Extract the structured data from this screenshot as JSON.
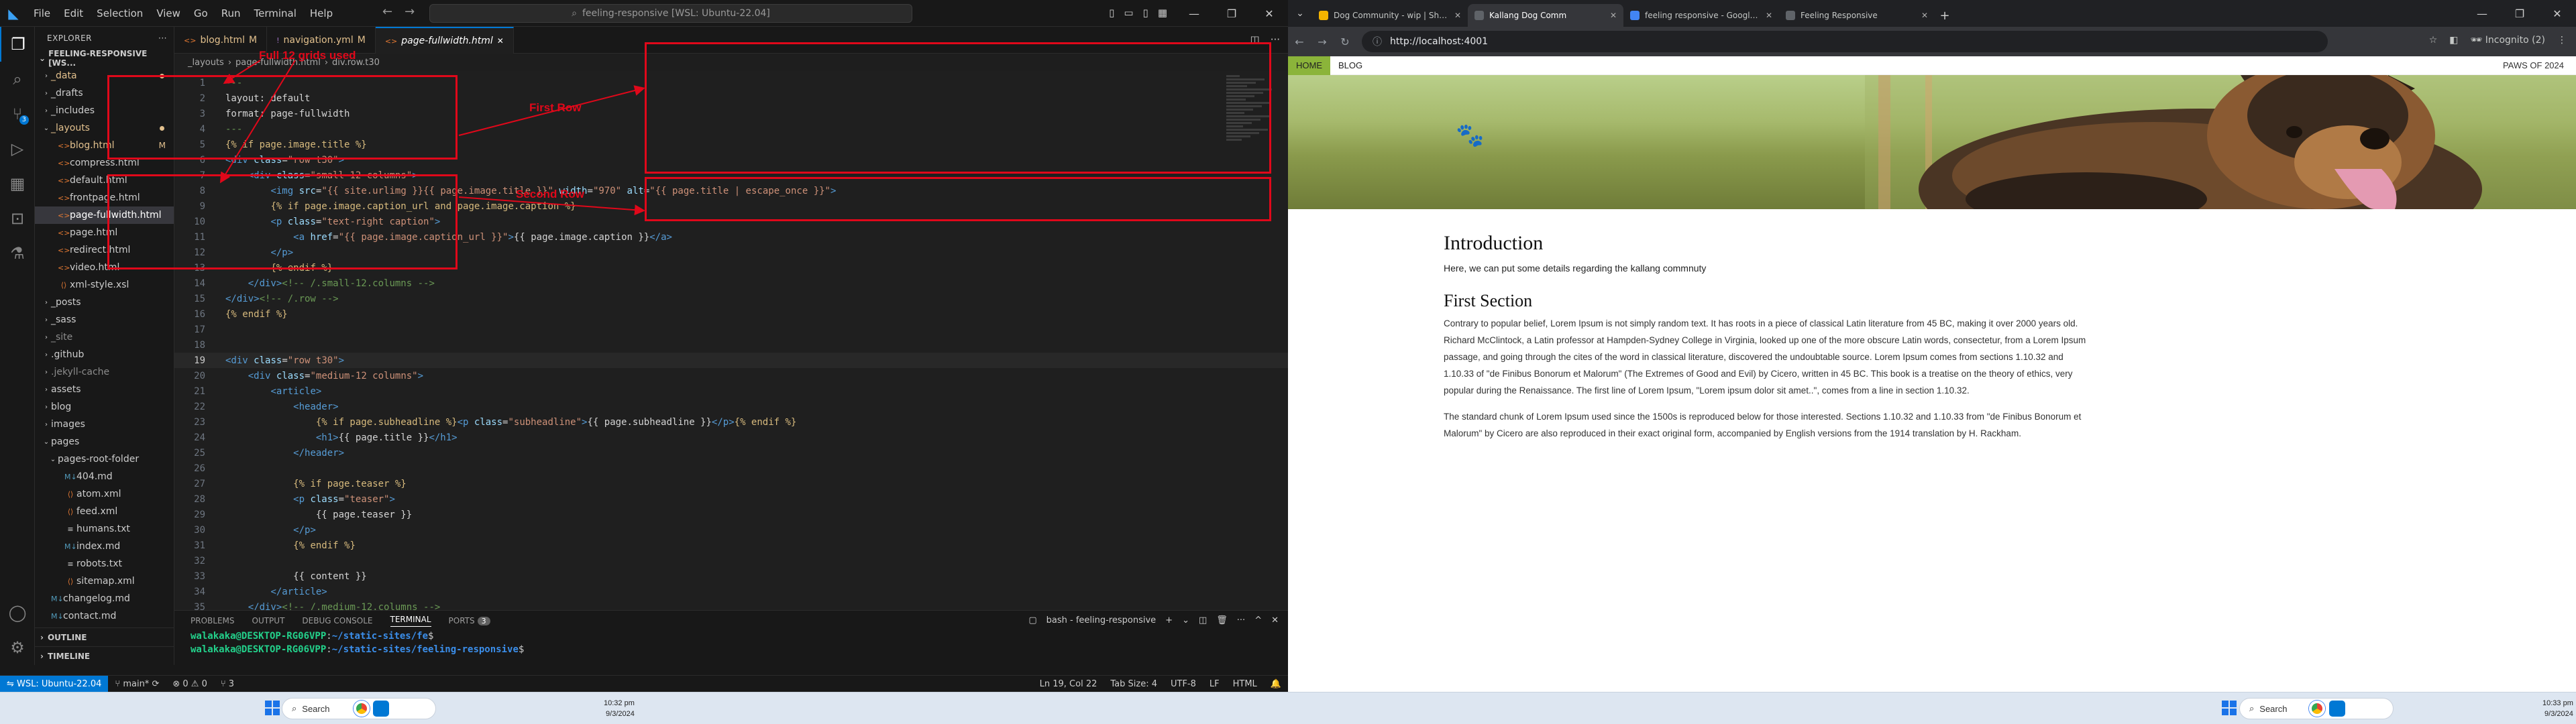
{
  "vscode": {
    "title": "feeling-responsive [WSL: Ubuntu-22.04]",
    "menu": [
      "File",
      "Edit",
      "Selection",
      "View",
      "Go",
      "Run",
      "Terminal",
      "Help"
    ],
    "explorer_title": "EXPLORER",
    "project": "FEELING-RESPONSIVE [WS...",
    "tree": [
      {
        "label": "_data",
        "indent": 1,
        "folder": true,
        "color": "#e2c08d",
        "dot": true
      },
      {
        "label": "_drafts",
        "indent": 1,
        "folder": true,
        "color": "#cccccc"
      },
      {
        "label": "_includes",
        "indent": 1,
        "folder": true,
        "color": "#cccccc"
      },
      {
        "label": "_layouts",
        "indent": 1,
        "folder": true,
        "open": true,
        "color": "#e2c08d",
        "dot": true
      },
      {
        "label": "blog.html",
        "indent": 2,
        "file": "html",
        "color": "#e2c08d",
        "mark": "M"
      },
      {
        "label": "compress.html",
        "indent": 2,
        "file": "html",
        "color": "#cccccc"
      },
      {
        "label": "default.html",
        "indent": 2,
        "file": "html",
        "color": "#cccccc"
      },
      {
        "label": "frontpage.html",
        "indent": 2,
        "file": "html",
        "color": "#cccccc"
      },
      {
        "label": "page-fullwidth.html",
        "indent": 2,
        "file": "html",
        "color": "#ffffff",
        "selected": true
      },
      {
        "label": "page.html",
        "indent": 2,
        "file": "html",
        "color": "#cccccc"
      },
      {
        "label": "redirect.html",
        "indent": 2,
        "file": "html",
        "color": "#cccccc"
      },
      {
        "label": "video.html",
        "indent": 2,
        "file": "html",
        "color": "#cccccc"
      },
      {
        "label": "xml-style.xsl",
        "indent": 2,
        "file": "xsl",
        "color": "#cccccc"
      },
      {
        "label": "_posts",
        "indent": 1,
        "folder": true,
        "color": "#cccccc"
      },
      {
        "label": "_sass",
        "indent": 1,
        "folder": true,
        "color": "#cccccc"
      },
      {
        "label": "_site",
        "indent": 1,
        "folder": true,
        "color": "#8c8c8c"
      },
      {
        "label": ".github",
        "indent": 1,
        "folder": true,
        "color": "#cccccc"
      },
      {
        "label": ".jekyll-cache",
        "indent": 1,
        "folder": true,
        "color": "#8c8c8c"
      },
      {
        "label": "assets",
        "indent": 1,
        "folder": true,
        "color": "#cccccc"
      },
      {
        "label": "blog",
        "indent": 1,
        "folder": true,
        "color": "#cccccc"
      },
      {
        "label": "images",
        "indent": 1,
        "folder": true,
        "color": "#cccccc"
      },
      {
        "label": "pages",
        "indent": 1,
        "folder": true,
        "open": true,
        "color": "#cccccc"
      },
      {
        "label": "pages-root-folder",
        "indent": 2,
        "folder": true,
        "open": true,
        "color": "#cccccc"
      },
      {
        "label": "404.md",
        "indent": 3,
        "file": "md",
        "color": "#cccccc"
      },
      {
        "label": "atom.xml",
        "indent": 3,
        "file": "xml",
        "color": "#cccccc"
      },
      {
        "label": "feed.xml",
        "indent": 3,
        "file": "xml",
        "color": "#cccccc"
      },
      {
        "label": "humans.txt",
        "indent": 3,
        "file": "txt",
        "color": "#cccccc"
      },
      {
        "label": "index.md",
        "indent": 3,
        "file": "md",
        "color": "#cccccc"
      },
      {
        "label": "robots.txt",
        "indent": 3,
        "file": "txt",
        "color": "#cccccc"
      },
      {
        "label": "sitemap.xml",
        "indent": 3,
        "file": "xml",
        "color": "#cccccc"
      },
      {
        "label": "changelog.md",
        "indent": 1,
        "file": "md",
        "color": "#cccccc"
      },
      {
        "label": "contact.md",
        "indent": 1,
        "file": "md",
        "color": "#cccccc"
      }
    ],
    "outline": "OUTLINE",
    "timeline": "TIMELINE",
    "tabs": [
      {
        "label": "blog.html",
        "mark": "M",
        "active": false
      },
      {
        "label": "navigation.yml",
        "mark": "M",
        "active": false
      },
      {
        "label": "page-fullwidth.html",
        "mark": "",
        "active": true
      }
    ],
    "breadcrumb": [
      "_layouts",
      "page-fullwidth.html",
      "div.row.t30"
    ],
    "code": [
      {
        "n": 1,
        "html": "<span class=\"cm\">---</span>"
      },
      {
        "n": 2,
        "html": "layout: default"
      },
      {
        "n": 3,
        "html": "format: page-fullwidth"
      },
      {
        "n": 4,
        "html": "<span class=\"cm\">---</span>"
      },
      {
        "n": 5,
        "html": "<span class=\"lq\">{% if page.image.title %}</span>"
      },
      {
        "n": 6,
        "html": "<span class=\"kw\">&lt;div</span> <span class=\"at\">class</span>=<span class=\"st\">\"row t30\"</span><span class=\"kw\">&gt;</span>"
      },
      {
        "n": 7,
        "html": "    <span class=\"kw\">&lt;div</span> <span class=\"at\">class</span>=<span class=\"st\">\"small-12 columns\"</span><span class=\"kw\">&gt;</span>"
      },
      {
        "n": 8,
        "html": "        <span class=\"kw\">&lt;img</span> <span class=\"at\">src</span>=<span class=\"st\">\"{{ site.urlimg }}{{ page.image.title }}\"</span> <span class=\"at\">width</span>=<span class=\"st\">\"970\"</span> <span class=\"at\">alt</span>=<span class=\"st\">\"{{ page.title | escape_once }}\"</span><span class=\"kw\">&gt;</span>"
      },
      {
        "n": 9,
        "html": "        <span class=\"lq\">{% if page.image.caption_url and page.image.caption %}</span>"
      },
      {
        "n": 10,
        "html": "        <span class=\"kw\">&lt;p</span> <span class=\"at\">class</span>=<span class=\"st\">\"text-right caption\"</span><span class=\"kw\">&gt;</span>"
      },
      {
        "n": 11,
        "html": "            <span class=\"kw\">&lt;a</span> <span class=\"at\">href</span>=<span class=\"st\">\"{{ page.image.caption_url }}\"</span><span class=\"kw\">&gt;</span>{{ page.image.caption }}<span class=\"kw\">&lt;/a&gt;</span>"
      },
      {
        "n": 12,
        "html": "        <span class=\"kw\">&lt;/p&gt;</span>"
      },
      {
        "n": 13,
        "html": "        <span class=\"lq\">{% endif %}</span>"
      },
      {
        "n": 14,
        "html": "    <span class=\"kw\">&lt;/div&gt;</span><span class=\"cm\">&lt;!-- /.small-12.columns --&gt;</span>"
      },
      {
        "n": 15,
        "html": "<span class=\"kw\">&lt;/div&gt;</span><span class=\"cm\">&lt;!-- /.row --&gt;</span>"
      },
      {
        "n": 16,
        "html": "<span class=\"lq\">{% endif %}</span>"
      },
      {
        "n": 17,
        "html": ""
      },
      {
        "n": 18,
        "html": ""
      },
      {
        "n": 19,
        "html": "<span class=\"kw\">&lt;div</span> <span class=\"at\">class</span>=<span class=\"st\">\"row t30\"</span><span class=\"kw\">&gt;</span>",
        "cur": true
      },
      {
        "n": 20,
        "html": "    <span class=\"kw\">&lt;div</span> <span class=\"at\">class</span>=<span class=\"st\">\"medium-12 columns\"</span><span class=\"kw\">&gt;</span>"
      },
      {
        "n": 21,
        "html": "        <span class=\"kw\">&lt;article&gt;</span>"
      },
      {
        "n": 22,
        "html": "            <span class=\"kw\">&lt;header&gt;</span>"
      },
      {
        "n": 23,
        "html": "                <span class=\"lq\">{% if page.subheadline %}</span><span class=\"kw\">&lt;p</span> <span class=\"at\">class</span>=<span class=\"st\">\"subheadline\"</span><span class=\"kw\">&gt;</span>{{ page.subheadline }}<span class=\"kw\">&lt;/p&gt;</span><span class=\"lq\">{% endif %}</span>"
      },
      {
        "n": 24,
        "html": "                <span class=\"kw\">&lt;h1&gt;</span>{{ page.title }}<span class=\"kw\">&lt;/h1&gt;</span>"
      },
      {
        "n": 25,
        "html": "            <span class=\"kw\">&lt;/header&gt;</span>"
      },
      {
        "n": 26,
        "html": ""
      },
      {
        "n": 27,
        "html": "            <span class=\"lq\">{% if page.teaser %}</span>"
      },
      {
        "n": 28,
        "html": "            <span class=\"kw\">&lt;p</span> <span class=\"at\">class</span>=<span class=\"st\">\"teaser\"</span><span class=\"kw\">&gt;</span>"
      },
      {
        "n": 29,
        "html": "                {{ page.teaser }}"
      },
      {
        "n": 30,
        "html": "            <span class=\"kw\">&lt;/p&gt;</span>"
      },
      {
        "n": 31,
        "html": "            <span class=\"lq\">{% endif %}</span>"
      },
      {
        "n": 32,
        "html": ""
      },
      {
        "n": 33,
        "html": "            {{ content }}"
      },
      {
        "n": 34,
        "html": "        <span class=\"kw\">&lt;/article&gt;</span>"
      },
      {
        "n": 35,
        "html": "    <span class=\"kw\">&lt;/div&gt;</span><span class=\"cm\">&lt;!-- /.medium-12.columns --&gt;</span>"
      }
    ],
    "panel_tabs": [
      "PROBLEMS",
      "OUTPUT",
      "DEBUG CONSOLE",
      "TERMINAL",
      "PORTS"
    ],
    "ports_count": "3",
    "terminal_name": "bash - feeling-responsive",
    "terminal_lines": [
      {
        "user": "walakaka@DESKTOP-RG06VPP",
        "path": "~/static-sites/fe"
      },
      {
        "user": "walakaka@DESKTOP-RG06VPP",
        "path": "~/static-sites/feeling-responsive"
      }
    ],
    "status": {
      "remote": "WSL: Ubuntu-22.04",
      "branch": "main*",
      "errors": "0",
      "warnings": "0",
      "ports": "3",
      "position": "Ln 19, Col 22",
      "tab_size": "Tab Size: 4",
      "encoding": "UTF-8",
      "eol": "LF",
      "lang": "HTML"
    }
  },
  "chrome": {
    "tabs": [
      {
        "label": "Dog Community - wip | Shafik",
        "color": "#f4b400",
        "active": false
      },
      {
        "label": "Kallang Dog Comm",
        "color": "#5f6368",
        "active": true
      },
      {
        "label": "feeling responsive - Google Se",
        "color": "#4285f4",
        "active": false
      },
      {
        "label": "Feeling Responsive",
        "color": "#5f6368",
        "active": false
      }
    ],
    "url": "http://localhost:4001",
    "incognito": "Incognito (2)"
  },
  "site": {
    "nav": {
      "home": "HOME",
      "blog": "BLOG",
      "brand": "PAWS OF 2024"
    },
    "intro_title": "Introduction",
    "intro_text": "Here, we can put some details regarding the kallang commnuty",
    "section_title": "First Section",
    "para1": "Contrary to popular belief, Lorem Ipsum is not simply random text. It has roots in a piece of classical Latin literature from 45 BC, making it over 2000 years old. Richard McClintock, a Latin professor at Hampden-Sydney College in Virginia, looked up one of the more obscure Latin words, consectetur, from a Lorem Ipsum passage, and going through the cites of the word in classical literature, discovered the undoubtable source. Lorem Ipsum comes from sections 1.10.32 and 1.10.33 of \"de Finibus Bonorum et Malorum\" (The Extremes of Good and Evil) by Cicero, written in 45 BC. This book is a treatise on the theory of ethics, very popular during the Renaissance. The first line of Lorem Ipsum, \"Lorem ipsum dolor sit amet..\", comes from a line in section 1.10.32.",
    "para2": "The standard chunk of Lorem Ipsum used since the 1500s is reproduced below for those interested. Sections 1.10.32 and 1.10.33 from \"de Finibus Bonorum et Malorum\" by Cicero are also reproduced in their exact original form, accompanied by English versions from the 1914 translation by H. Rackham."
  },
  "annotations": {
    "grids_label": "Full 12 grids used",
    "first_row": "First Row",
    "second_row": "Second Row",
    "color": "#e0081a"
  },
  "taskbar": {
    "search": "Search",
    "left_time": "10:32 pm",
    "left_date": "9/3/2024",
    "right_time": "10:33 pm",
    "right_date": "9/3/2024"
  }
}
